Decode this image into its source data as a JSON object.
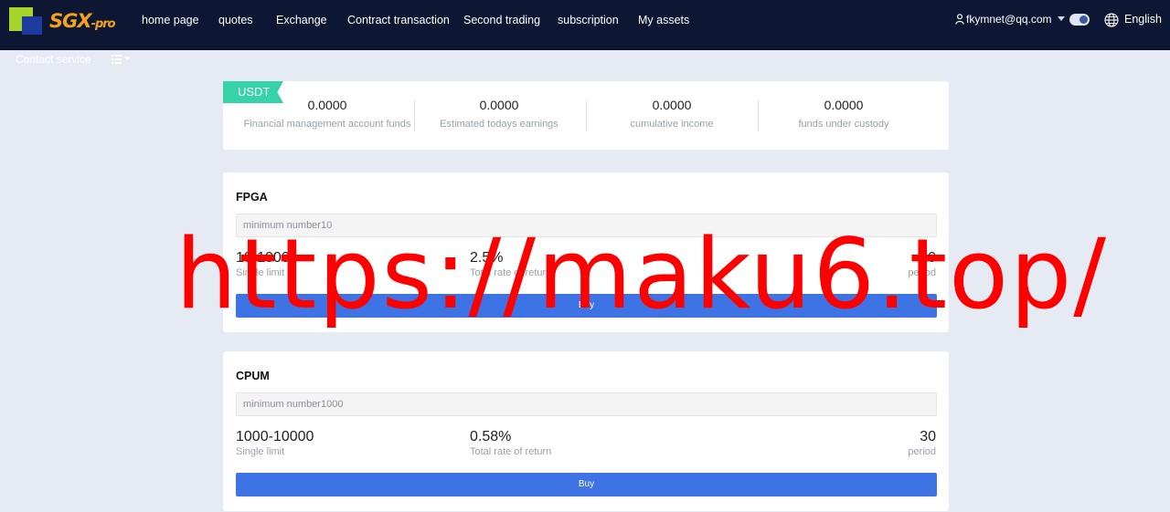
{
  "header": {
    "logo_text": "SGX",
    "logo_suffix": "-pro",
    "nav": [
      "home page",
      "quotes",
      "Exchange",
      "Contract transaction",
      "Second trading",
      "subscription",
      "My assets"
    ],
    "user_email": "fkymnet@qq.com",
    "language": "English",
    "contact_service": "Contact service"
  },
  "summary": {
    "tag": "USDT",
    "stats": [
      {
        "value": "0.0000",
        "label": "Financial management account funds"
      },
      {
        "value": "0.0000",
        "label": "Estimated todays earnings"
      },
      {
        "value": "0.0000",
        "label": "cumulative income"
      },
      {
        "value": "0.0000",
        "label": "funds under custody"
      }
    ]
  },
  "products": [
    {
      "name": "FPGA",
      "placeholder": "minimum number10",
      "limit": "10-1000",
      "limit_label": "Single limit",
      "rate": "2.5%",
      "rate_label": "Total rate of return",
      "period": "30",
      "period_label": "period",
      "buy_label": "Buy"
    },
    {
      "name": "CPUM",
      "placeholder": "minimum number1000",
      "limit": "1000-10000",
      "limit_label": "Single limit",
      "rate": "0.58%",
      "rate_label": "Total rate of return",
      "period": "30",
      "period_label": "period",
      "buy_label": "Buy"
    }
  ],
  "watermark": "https://maku6.top/",
  "colors": {
    "nav_bg": "#0d1733",
    "page_bg": "#e6ebf3",
    "usdt_tag": "#35d3a6",
    "buy_button": "#3e73e6",
    "logo_orange": "#f5a11c",
    "logo_green": "#a5d42b",
    "watermark": "#ff0000"
  }
}
